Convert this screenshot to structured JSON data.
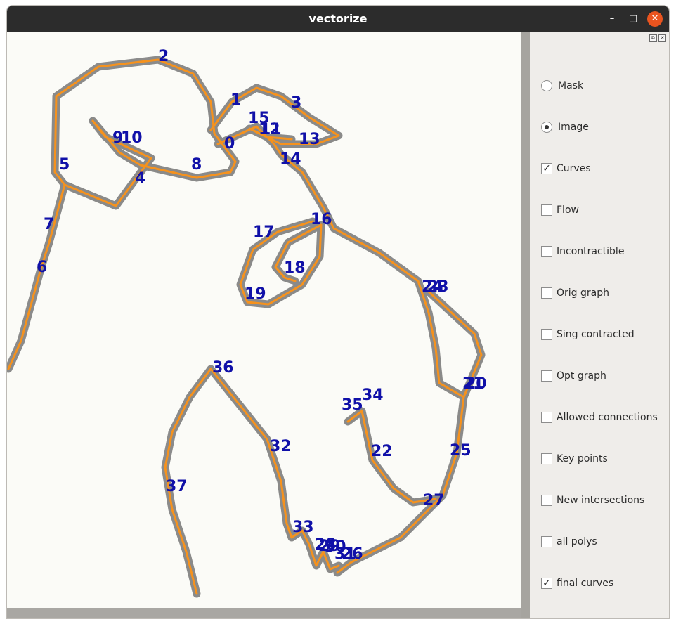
{
  "window": {
    "title": "vectorize"
  },
  "titlebar_buttons": {
    "minimize": "–",
    "maximize": "□",
    "close": "✕"
  },
  "dock_buttons": {
    "float": "⧉",
    "close": "✕"
  },
  "panel": {
    "options": [
      {
        "kind": "radio",
        "label": "Mask",
        "checked": false
      },
      {
        "kind": "radio",
        "label": "Image",
        "checked": true
      },
      {
        "kind": "check",
        "label": "Curves",
        "checked": true
      },
      {
        "kind": "check",
        "label": "Flow",
        "checked": false
      },
      {
        "kind": "check",
        "label": "Incontractible",
        "checked": false
      },
      {
        "kind": "check",
        "label": "Orig graph",
        "checked": false
      },
      {
        "kind": "check",
        "label": "Sing contracted",
        "checked": false
      },
      {
        "kind": "check",
        "label": "Opt graph",
        "checked": false
      },
      {
        "kind": "check",
        "label": "Allowed connections",
        "checked": false
      },
      {
        "kind": "check",
        "label": "Key points",
        "checked": false
      },
      {
        "kind": "check",
        "label": "New intersections",
        "checked": false
      },
      {
        "kind": "check",
        "label": "all polys",
        "checked": false
      },
      {
        "kind": "check",
        "label": "final curves",
        "checked": true
      }
    ]
  },
  "canvas": {
    "curve_color": "#f5921e",
    "stroke_color": "#7e7e7e",
    "label_color": "#1010a8",
    "labels": [
      "2",
      "1",
      "3",
      "15",
      "12",
      "11",
      "9",
      "10",
      "13",
      "0",
      "14",
      "5",
      "8",
      "4",
      "7",
      "16",
      "17",
      "6",
      "18",
      "19",
      "24",
      "23",
      "21",
      "20",
      "36",
      "34",
      "35",
      "32",
      "22",
      "25",
      "37",
      "27",
      "33",
      "28",
      "29",
      "30",
      "31",
      "26"
    ]
  }
}
